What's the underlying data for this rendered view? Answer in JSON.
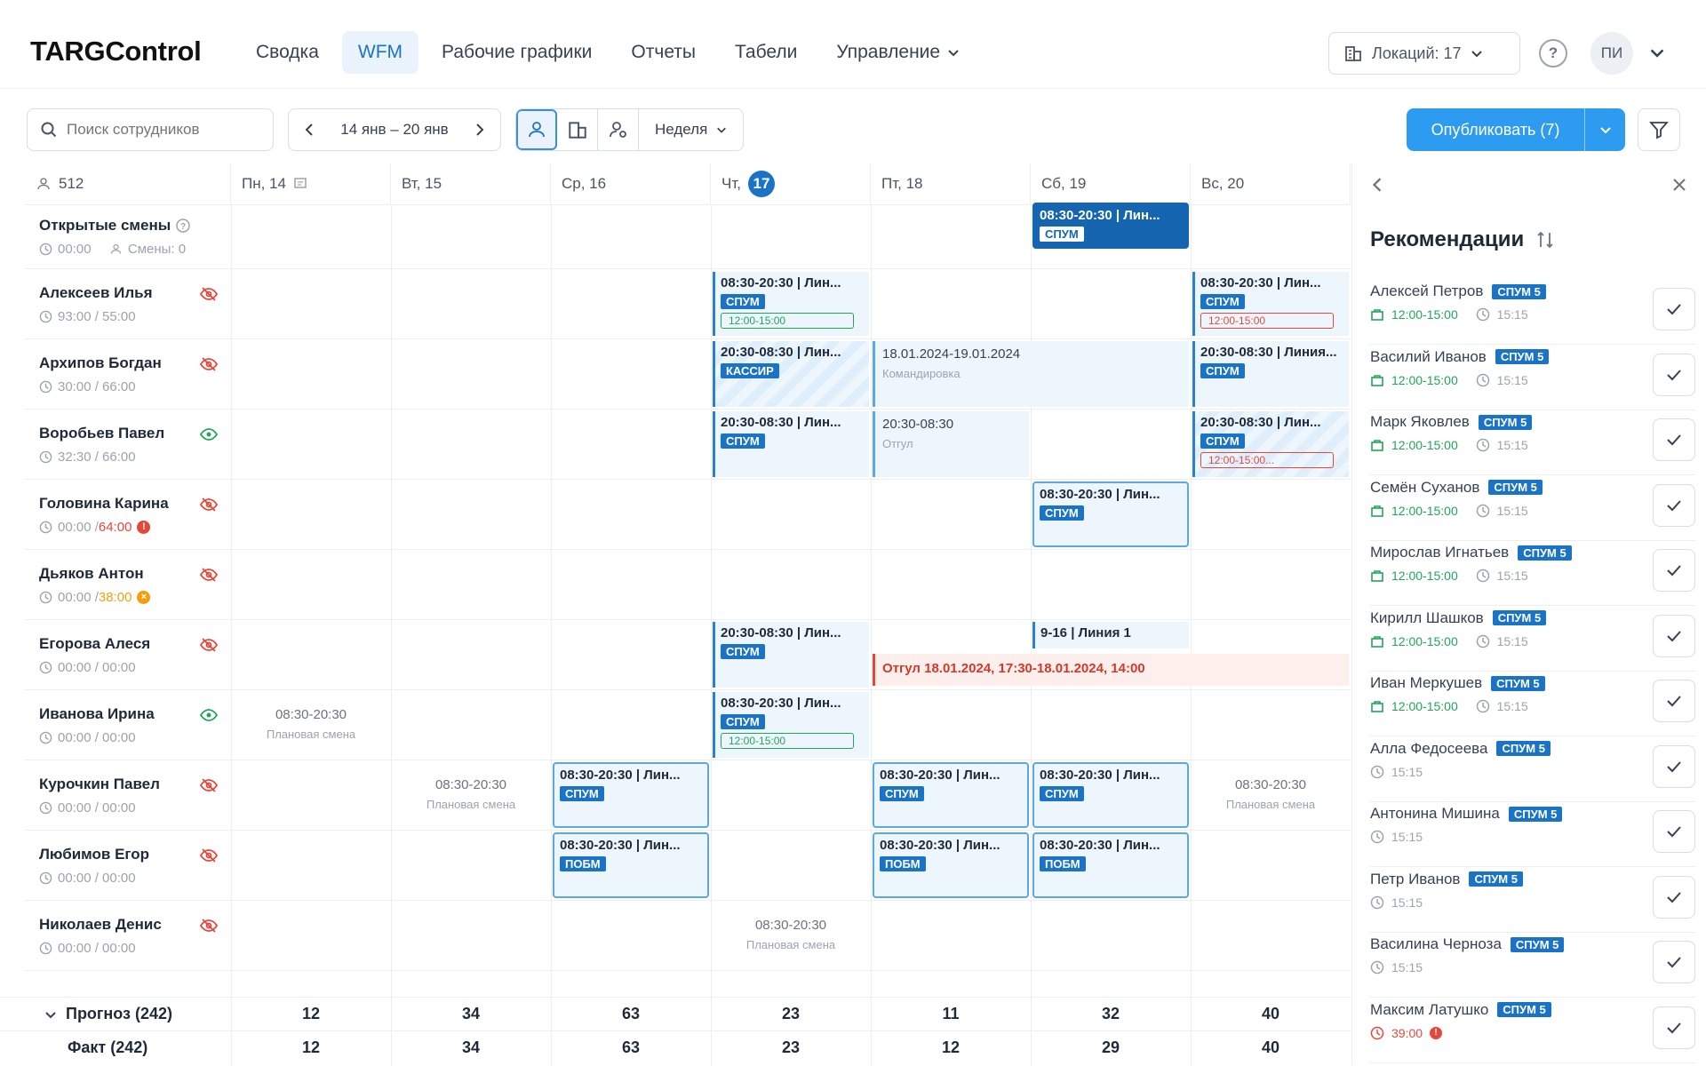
{
  "app": {
    "logo": "TARGControl"
  },
  "nav": [
    {
      "label": "Сводка",
      "active": false
    },
    {
      "label": "WFM",
      "active": true
    },
    {
      "label": "Рабочие графики",
      "active": false
    },
    {
      "label": "Отчеты",
      "active": false
    },
    {
      "label": "Табели",
      "active": false
    },
    {
      "label": "Управление",
      "active": false
    }
  ],
  "header": {
    "location": "Локаций: 17",
    "avatar": "ПИ",
    "help": "?"
  },
  "toolbar": {
    "search_placeholder": "Поиск сотрудников",
    "date_range": "14 янв – 20 янв",
    "period": "Неделя",
    "publish": "Опубликовать (7)"
  },
  "grid": {
    "headcount": "512",
    "days": [
      {
        "label": "Пн, 14"
      },
      {
        "label": "Вт, 15"
      },
      {
        "label": "Ср, 16"
      },
      {
        "label": "Чт,",
        "num": "17"
      },
      {
        "label": "Пт, 18"
      },
      {
        "label": "Сб, 19"
      },
      {
        "label": "Вс, 20"
      }
    ],
    "open_shifts": {
      "title": "Открытые смены",
      "hours": "00:00",
      "shifts": "Смены: 0"
    },
    "employees": [
      {
        "name": "Алексеев Илья",
        "hours": "93:00 / 55:00",
        "status": "off"
      },
      {
        "name": "Архипов Богдан",
        "hours": "30:00 / 66:00",
        "status": "off"
      },
      {
        "name": "Воробьев Павел",
        "hours": "32:30 / 66:00",
        "status": "on"
      },
      {
        "name": "Головина Карина",
        "hours": "00:00 / ",
        "hours_alert": "64:00",
        "status": "off",
        "alert": "red"
      },
      {
        "name": "Дьяков Антон",
        "hours": "00:00 / ",
        "hours_alert": "38:00",
        "status": "off",
        "alert": "orange"
      },
      {
        "name": "Егорова Алеся",
        "hours": "00:00 / 00:00",
        "status": "off"
      },
      {
        "name": "Иванова Ирина",
        "hours": "00:00 / 00:00",
        "status": "on"
      },
      {
        "name": "Курочкин Павел",
        "hours": "00:00 / 00:00",
        "status": "off"
      },
      {
        "name": "Любимов Егор",
        "hours": "00:00 / 00:00",
        "status": "off"
      },
      {
        "name": "Николаев Денис",
        "hours": "00:00 / 00:00",
        "status": "off"
      }
    ],
    "shift_text": {
      "s1": "08:30-20:30 | Лин...",
      "s2": "20:30-08:30 | Лин...",
      "s3": "20:30-08:30 | Линия...",
      "s4": "08:30-20:30 | Лин...",
      "s5": "9-16 | Линия 1",
      "plan": "08:30-20:30",
      "plan_sub": "Плановая смена",
      "tag_spum": "СПУМ",
      "tag_kassir": "КАССИР",
      "tag_pobm": "ПОБМ",
      "break": "12:00-15:00",
      "break_more": "12:00-15:00...",
      "trip_dates": "18.01.2024-19.01.2024",
      "trip": "Командировка",
      "otgul_time": "20:30-08:30",
      "otgul": "Отгул",
      "absence": "Отгул 18.01.2024, 17:30-18.01.2024, 14:00"
    },
    "forecast": {
      "label": "Прогноз (242)",
      "values": [
        "12",
        "34",
        "63",
        "23",
        "11",
        "32",
        "40"
      ]
    },
    "fact": {
      "label": "Факт (242)",
      "values": [
        "12",
        "34",
        "63",
        "23",
        "12",
        "29",
        "40"
      ]
    }
  },
  "panel": {
    "title": "Рекомендации",
    "items": [
      {
        "name": "Алексей Петров",
        "tag": "СПУМ 5",
        "break": "12:00-15:00",
        "time": "15:15"
      },
      {
        "name": "Василий Иванов",
        "tag": "СПУМ 5",
        "break": "12:00-15:00",
        "time": "15:15"
      },
      {
        "name": "Марк Яковлев",
        "tag": "СПУМ 5",
        "break": "12:00-15:00",
        "time": "15:15"
      },
      {
        "name": "Семён Суханов",
        "tag": "СПУМ 5",
        "break": "12:00-15:00",
        "time": "15:15"
      },
      {
        "name": "Мирослав Игнатьев",
        "tag": "СПУМ 5",
        "break": "12:00-15:00",
        "time": "15:15"
      },
      {
        "name": "Кирилл Шашков",
        "tag": "СПУМ 5",
        "break": "12:00-15:00",
        "time": "15:15"
      },
      {
        "name": "Иван Меркушев",
        "tag": "СПУМ 5",
        "break": "12:00-15:00",
        "time": "15:15"
      },
      {
        "name": "Алла Федосеева",
        "tag": "СПУМ 5",
        "break": "",
        "time": "15:15"
      },
      {
        "name": "Антонина Мишина",
        "tag": "СПУМ 5",
        "break": "",
        "time": "15:15"
      },
      {
        "name": "Петр Иванов",
        "tag": "СПУМ 5",
        "break": "",
        "time": "15:15"
      },
      {
        "name": "Василина Черноза",
        "tag": "СПУМ 5",
        "break": "",
        "time": "15:15"
      },
      {
        "name": "Максим Латушко",
        "tag": "СПУМ 5",
        "break": "",
        "time": "",
        "alert_time": "39:00"
      }
    ]
  },
  "colors": {
    "accent": "#1a73c6",
    "publish": "#2d9cf0",
    "green": "#22a559",
    "red": "#e5483b",
    "orange": "#f59e0b"
  }
}
